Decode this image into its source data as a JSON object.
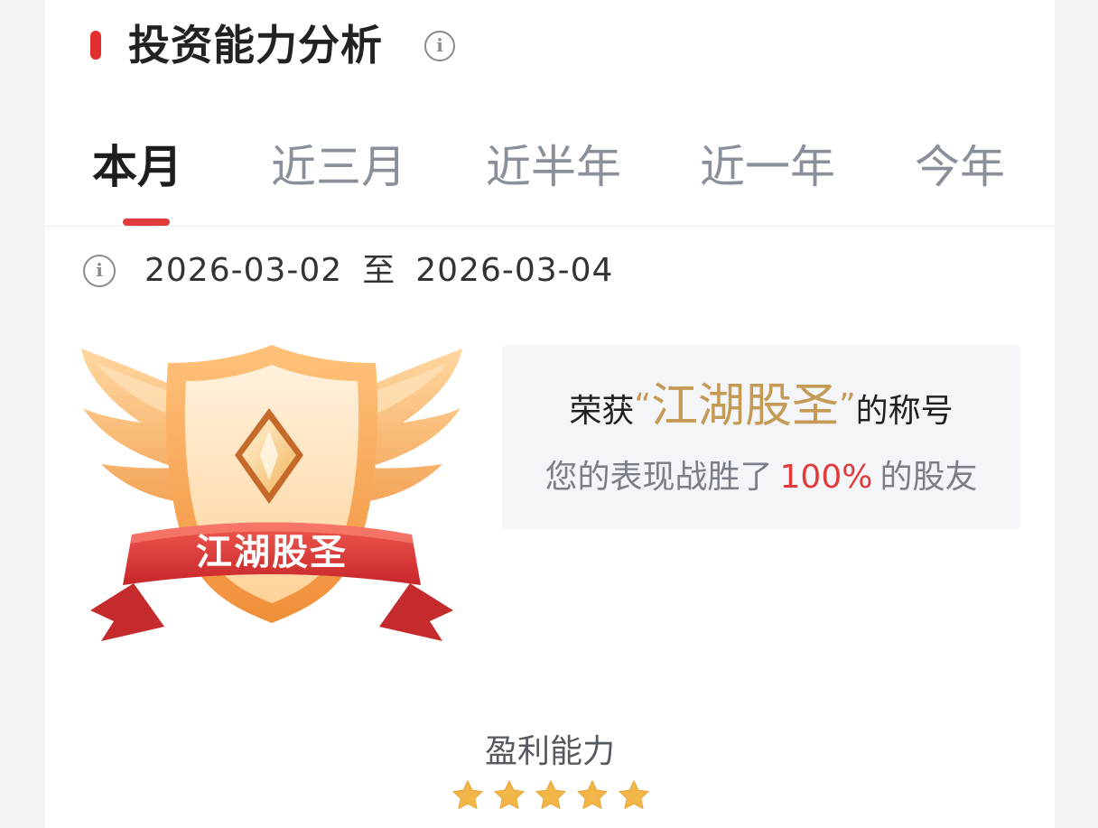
{
  "section": {
    "title": "投资能力分析",
    "info_icon": "info-circle-icon"
  },
  "tabs": [
    {
      "label": "本月",
      "active": true
    },
    {
      "label": "近三月",
      "active": false
    },
    {
      "label": "近半年",
      "active": false
    },
    {
      "label": "近一年",
      "active": false
    },
    {
      "label": "今年",
      "active": false
    }
  ],
  "date_range": {
    "start": "2026-03-02",
    "separator": "至",
    "end": "2026-03-04"
  },
  "badge": {
    "ribbon_text": "江湖股圣",
    "icon": "winged-shield-badge"
  },
  "award": {
    "prefix": "荣获",
    "open_quote": "“",
    "name": "江湖股圣",
    "close_quote": "”",
    "suffix": "的称号",
    "beat_prefix": "您的表现战胜了",
    "beat_percent": "100%",
    "beat_suffix": "的股友"
  },
  "metric": {
    "label": "盈利能力",
    "stars_filled": 5,
    "stars_total": 5
  },
  "colors": {
    "accent_red": "#e03a3a",
    "gold_text": "#c49a54",
    "star_gold": "#f2b548"
  }
}
